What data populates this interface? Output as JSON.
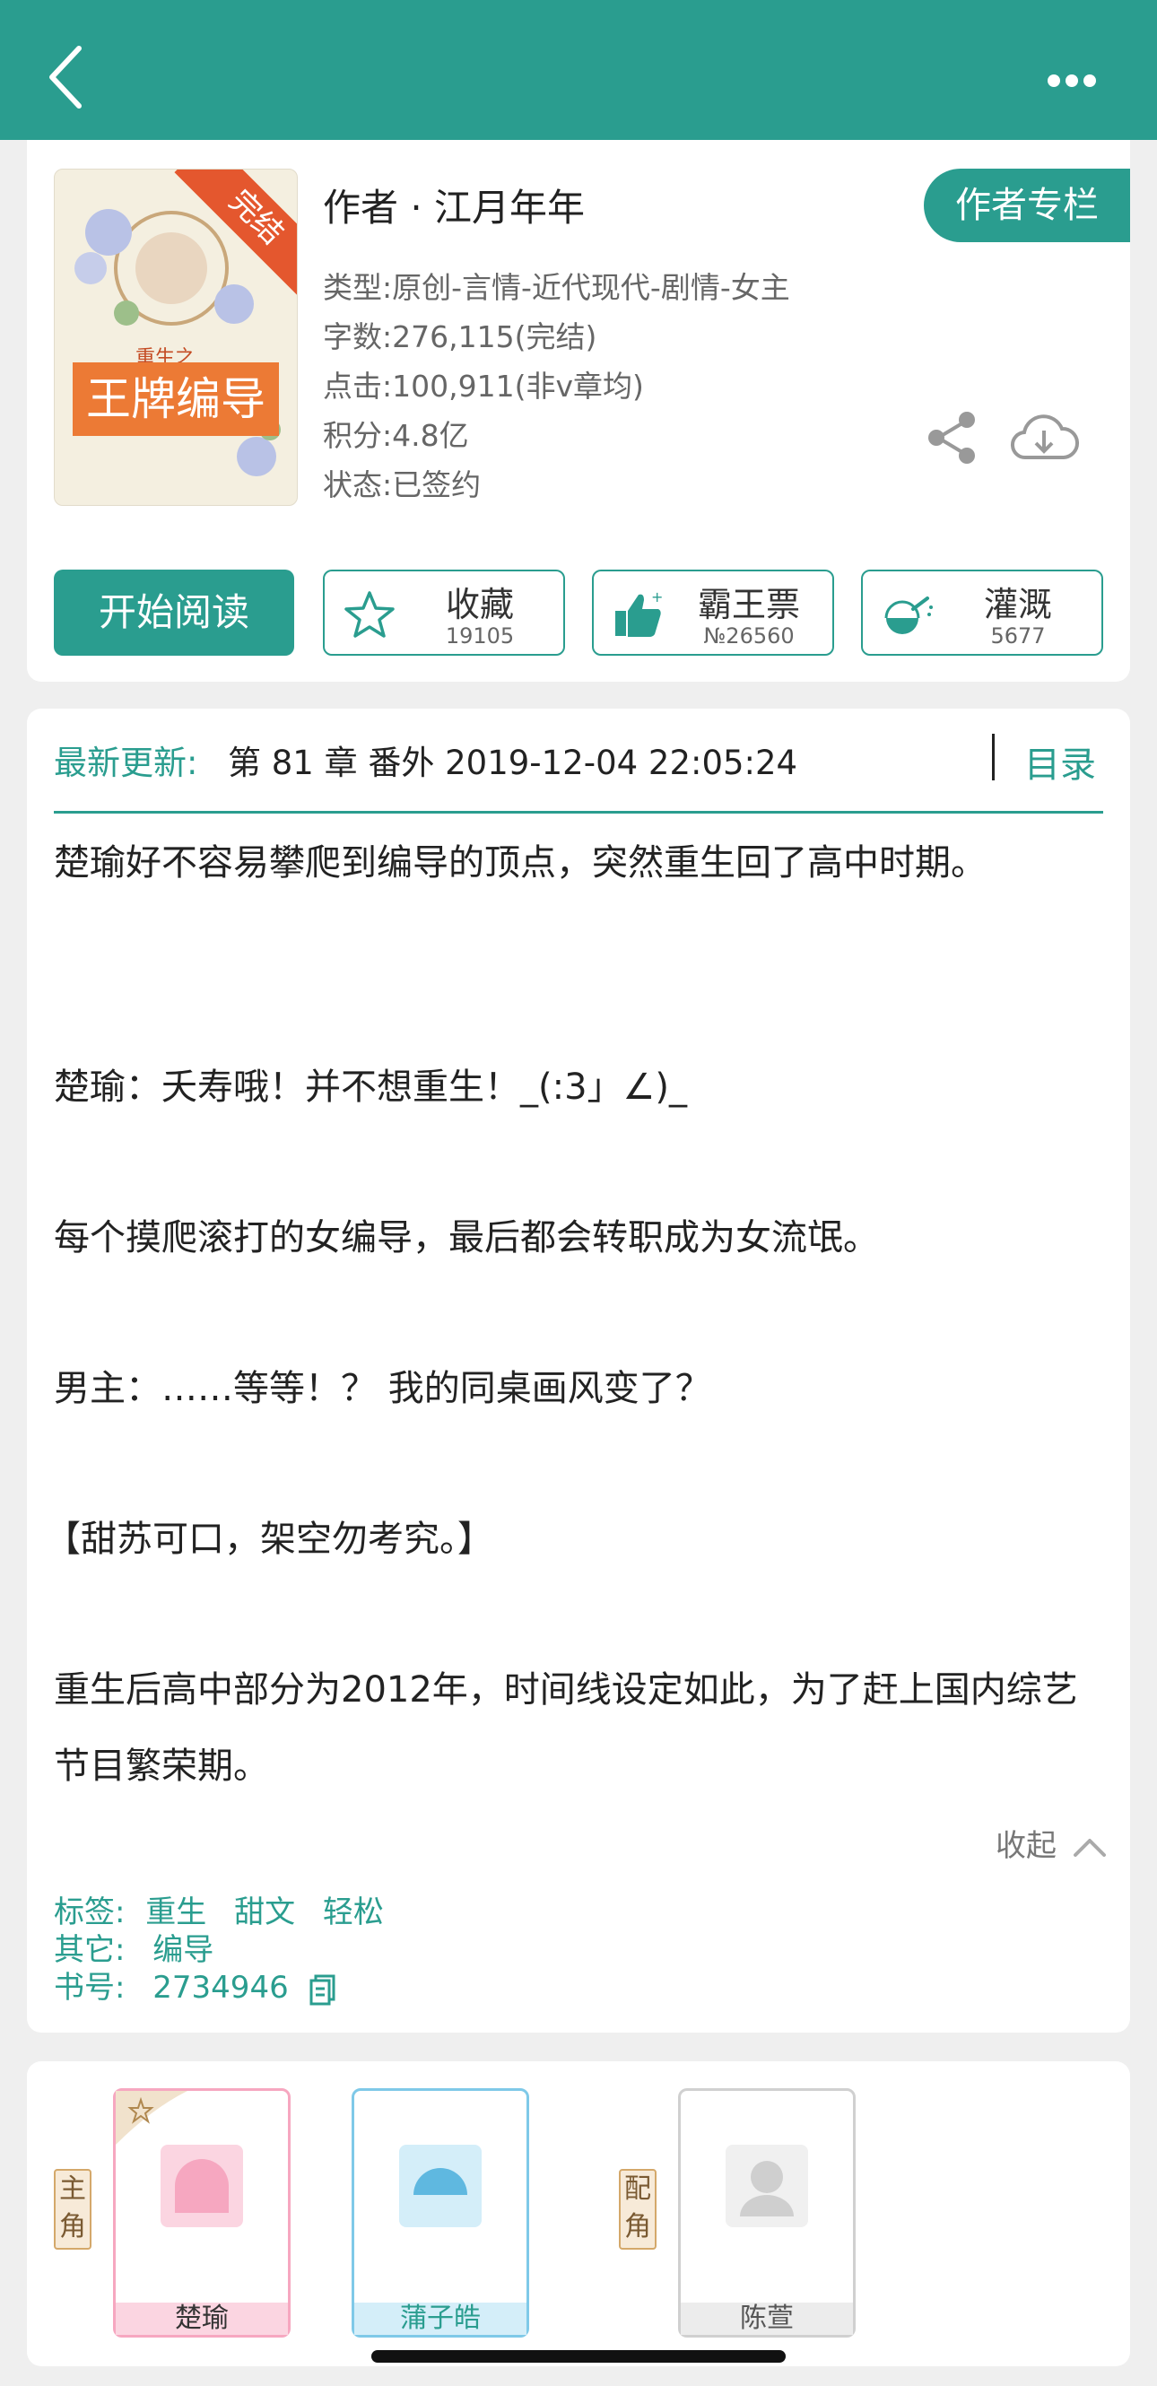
{
  "header": {
    "title": ""
  },
  "book": {
    "ribbon": "完结",
    "cover_subtitle": "重生之",
    "cover_title": "王牌编导",
    "author": "作者 · 江月年年",
    "author_column_button": "作者专栏",
    "meta": [
      "类型:原创-言情-近代现代-剧情-女主",
      "字数:276,115(完结)",
      "点击:100,911(非v章均)",
      "积分:4.8亿",
      "状态:已签约"
    ]
  },
  "actions": {
    "start_reading": "开始阅读",
    "collect": {
      "label": "收藏",
      "count": "19105"
    },
    "vote": {
      "label": "霸王票",
      "count": "№26560"
    },
    "water": {
      "label": "灌溉",
      "count": "5677"
    }
  },
  "latest": {
    "label": "最新更新:",
    "value": "第 81 章 番外 2019-12-04 22:05:24",
    "toc": "目录"
  },
  "description": {
    "paragraphs": [
      "楚瑜好不容易攀爬到编导的顶点，突然重生回了高中时期。",
      "楚瑜：夭寿哦！并不想重生！_(:3」∠)_",
      "每个摸爬滚打的女编导，最后都会转职成为女流氓。",
      "男主：……等等！？ 我的同桌画风变了？",
      "【甜苏可口，架空勿考究。】",
      "重生后高中部分为2012年，时间线设定如此，为了赶上国内综艺节目繁荣期。"
    ],
    "collapse": "收起"
  },
  "tags": {
    "tags_label": "标签:",
    "tags": [
      "重生",
      "甜文",
      "轻松"
    ],
    "other_label": "其它:",
    "other": "编导",
    "id_label": "书号:",
    "id": "2734946"
  },
  "characters": {
    "main_tag": [
      "主",
      "角"
    ],
    "side_tag": [
      "配",
      "角"
    ],
    "list": [
      {
        "name": "楚瑜",
        "role": "main",
        "color": "#f6a7c0"
      },
      {
        "name": "蒲子皓",
        "role": "main",
        "color": "#7fc9e8"
      },
      {
        "name": "陈萱",
        "role": "side",
        "color": "#cccccc"
      }
    ]
  },
  "colors": {
    "accent": "#2a9d8f",
    "orange": "#ec7a35"
  }
}
